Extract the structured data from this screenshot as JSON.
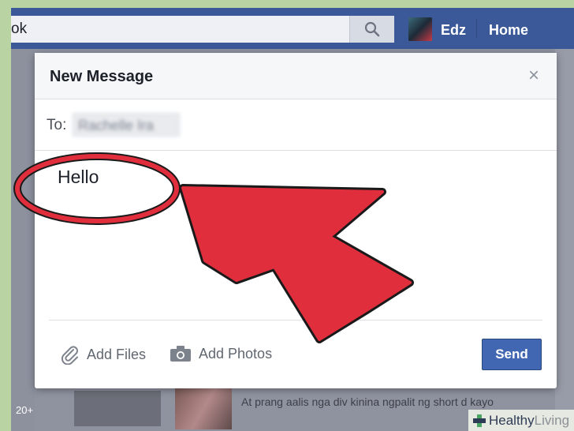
{
  "topbar": {
    "search_text": "ok",
    "user_name": "Edz",
    "home_label": "Home"
  },
  "background_feed": {
    "post_snippet": "At prang aalis nga div kinina ngpalit ng short d kayo",
    "side_count": "20+"
  },
  "dialog": {
    "title": "New Message",
    "close_label": "×",
    "to_label": "To:",
    "recipient": "Rachelle Ira",
    "message_text": "Hello",
    "add_files_label": "Add Files",
    "add_photos_label": "Add Photos",
    "send_label": "Send"
  },
  "annotations": {
    "arrow_color": "#e02e3d",
    "circle_color": "#e02e3d"
  },
  "watermark": {
    "part1": "Healthy",
    "part2": "Living"
  },
  "colors": {
    "facebook_blue": "#3b5998",
    "send_blue": "#4267b2",
    "dim_backdrop": "#8f93a1"
  }
}
